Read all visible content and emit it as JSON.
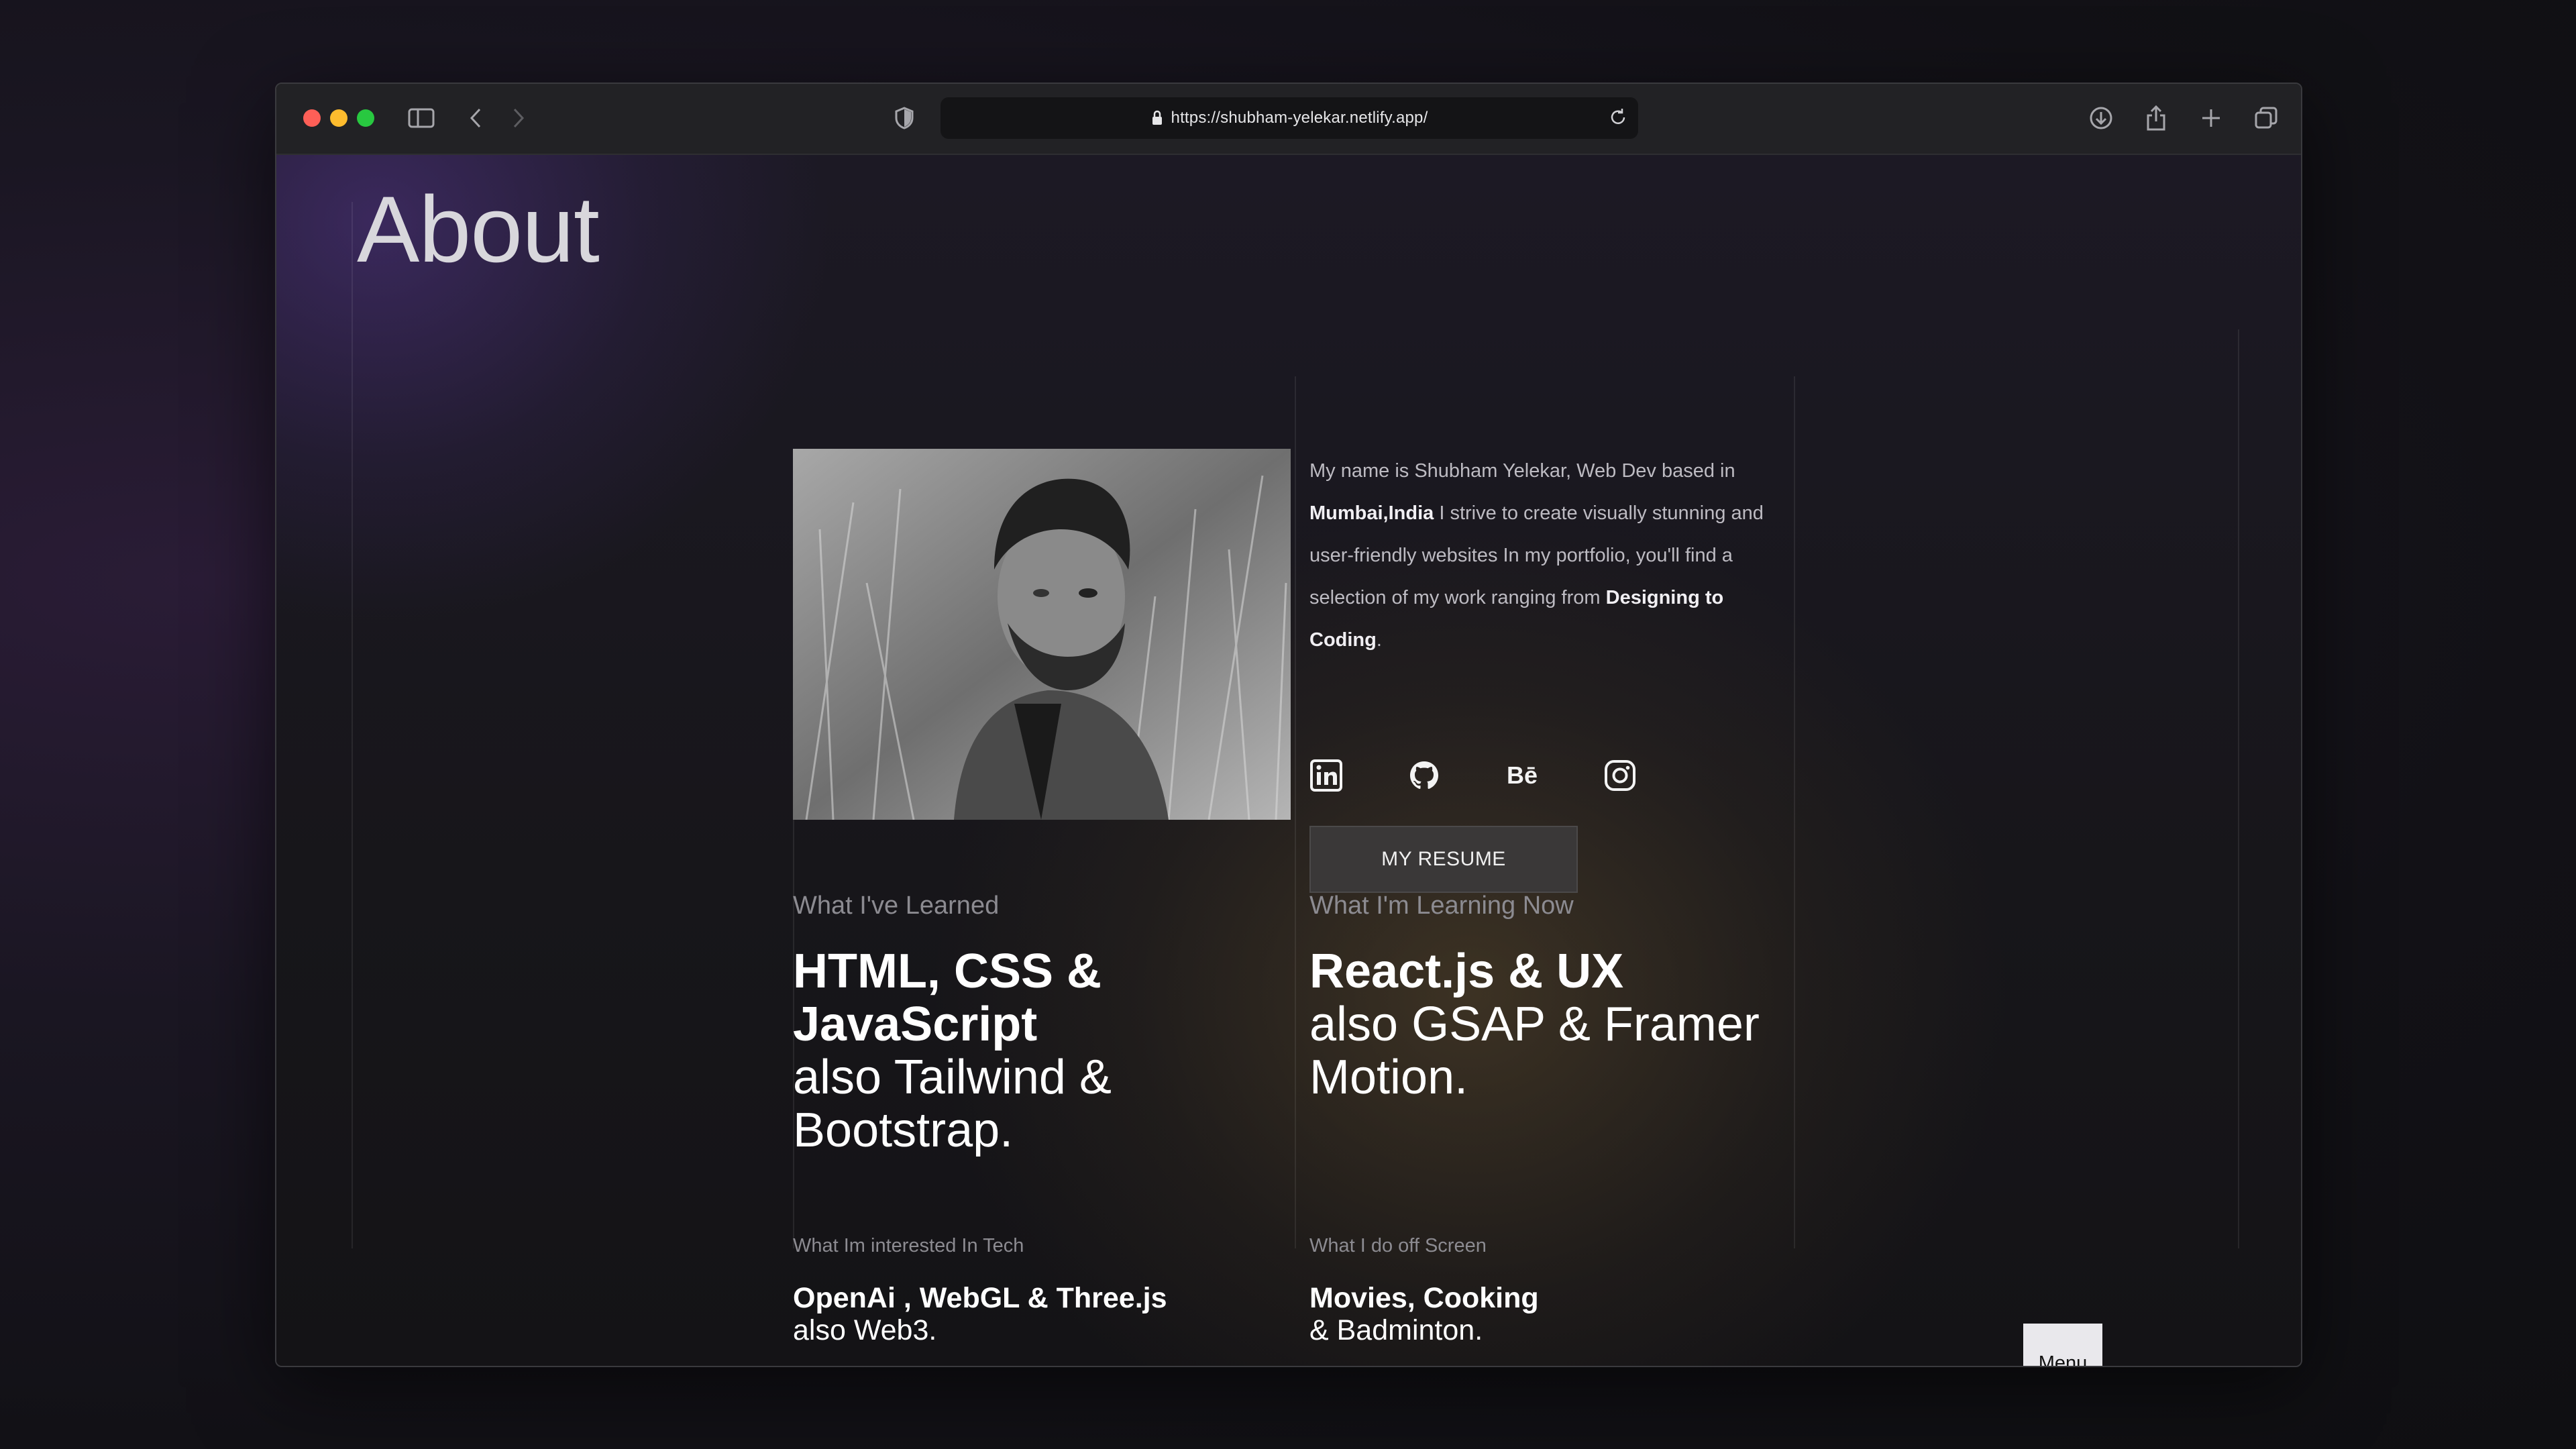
{
  "browser": {
    "url": "https://shubham-yelekar.netlify.app/",
    "icons": [
      "sidebar-icon",
      "back-icon",
      "forward-icon",
      "shield-icon",
      "lock-icon",
      "reload-icon",
      "download-icon",
      "share-icon",
      "new-tab-icon",
      "tabs-overview-icon"
    ]
  },
  "page": {
    "title": "About",
    "bio": {
      "p1": "My name is Shubham Yelekar, Web Dev based in ",
      "location": "Mumbai,India",
      "p2": " I strive to create visually stunning and user-friendly websites In my portfolio, you'll find a selection of my work ranging from ",
      "highlight": "Designing to Coding",
      "p3": "."
    },
    "socials": [
      {
        "name": "linkedin-icon"
      },
      {
        "name": "github-icon"
      },
      {
        "name": "behance-icon",
        "glyph": "Bē"
      },
      {
        "name": "instagram-icon"
      }
    ],
    "resume_label": "MY RESUME",
    "learned": {
      "label": "What I've Learned",
      "strong": "HTML, CSS & JavaScript",
      "rest": "also Tailwind & Bootstrap."
    },
    "learning": {
      "label": "What I'm Learning Now",
      "strong": "React.js & UX",
      "rest": "also GSAP & Framer Motion."
    },
    "interested": {
      "label": "What Im interested In Tech",
      "strong": "OpenAi , WebGL & Three.js",
      "rest": "also Web3."
    },
    "offscreen": {
      "label": "What I do off Screen",
      "strong": "Movies, Cooking",
      "rest": "& Badminton."
    },
    "menu_label": "Menu"
  },
  "colors": {
    "traffic_red": "#fe5f57",
    "traffic_yellow": "#febc2e",
    "traffic_green": "#28c840",
    "menu_bg": "#e9e8ec",
    "resume_bg": "#3a3838"
  }
}
